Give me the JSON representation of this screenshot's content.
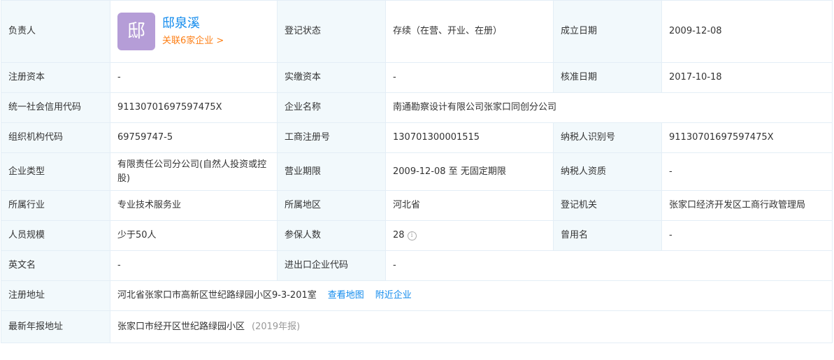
{
  "person": {
    "label": "负责人",
    "avatar_char": "邸",
    "name": "邸泉溪",
    "link": "关联6家企业 >"
  },
  "rows": {
    "reg_status": {
      "label": "登记状态",
      "value": "存续（在营、开业、在册）"
    },
    "found_date": {
      "label": "成立日期",
      "value": "2009-12-08"
    },
    "reg_capital": {
      "label": "注册资本",
      "value": "-"
    },
    "paid_capital": {
      "label": "实缴资本",
      "value": "-"
    },
    "approve_date": {
      "label": "核准日期",
      "value": "2017-10-18"
    },
    "credit_code": {
      "label": "统一社会信用代码",
      "value": "91130701697597475X"
    },
    "company_name": {
      "label": "企业名称",
      "value": "南通勘察设计有限公司张家口同创分公司"
    },
    "org_code": {
      "label": "组织机构代码",
      "value": "69759747-5"
    },
    "biz_reg_no": {
      "label": "工商注册号",
      "value": "130701300001515"
    },
    "taxpayer_id": {
      "label": "纳税人识别号",
      "value": "91130701697597475X"
    },
    "company_type": {
      "label": "企业类型",
      "value": "有限责任公司分公司(自然人投资或控股)"
    },
    "biz_term": {
      "label": "营业期限",
      "value": "2009-12-08 至 无固定期限"
    },
    "taxpayer_qual": {
      "label": "纳税人资质",
      "value": "-"
    },
    "industry": {
      "label": "所属行业",
      "value": "专业技术服务业"
    },
    "region": {
      "label": "所属地区",
      "value": "河北省"
    },
    "reg_authority": {
      "label": "登记机关",
      "value": "张家口经济开发区工商行政管理局"
    },
    "staff_size": {
      "label": "人员规模",
      "value": "少于50人"
    },
    "insured": {
      "label": "参保人数",
      "value": "28"
    },
    "former_name": {
      "label": "曾用名",
      "value": "-"
    },
    "english_name": {
      "label": "英文名",
      "value": "-"
    },
    "import_export": {
      "label": "进出口企业代码",
      "value": "-"
    },
    "reg_address": {
      "label": "注册地址",
      "value": "河北省张家口市高新区世纪路绿园小区9-3-201室",
      "map_link": "查看地图",
      "nearby_link": "附近企业"
    },
    "annual_address": {
      "label": "最新年报地址",
      "value": "张家口市经开区世纪路绿园小区",
      "note": "(2019年报)"
    }
  },
  "colors": {
    "label_bg": "#f2f9fc",
    "border": "#e4eef6",
    "link": "#128bed",
    "accent": "#fd7e14",
    "avatar_bg": "#b59dd7"
  }
}
